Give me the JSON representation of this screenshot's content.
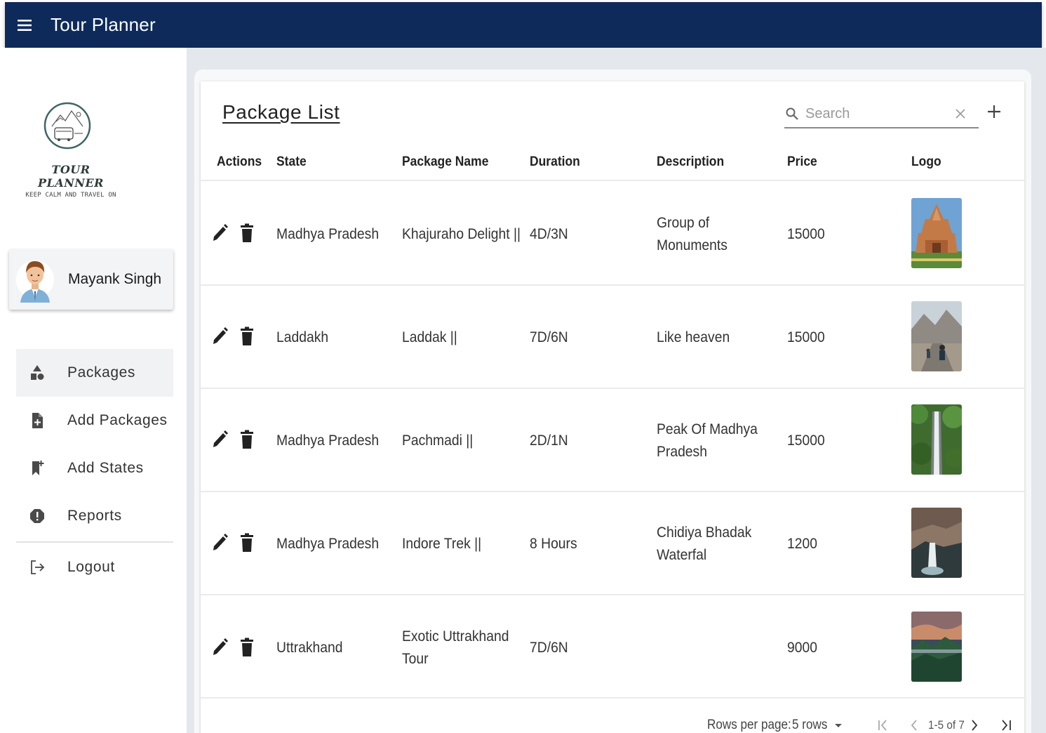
{
  "app": {
    "title": "Tour Planner"
  },
  "sidebar": {
    "logo": {
      "name": "TOUR PLANNER",
      "tagline": "KEEP CALM AND TRAVEL ON"
    },
    "user": {
      "name": "Mayank Singh"
    },
    "items": [
      {
        "label": "Packages",
        "icon": "packages-icon",
        "active": true
      },
      {
        "label": "Add Packages",
        "icon": "add-file-icon",
        "active": false
      },
      {
        "label": "Add States",
        "icon": "bookmark-add-icon",
        "active": false
      },
      {
        "label": "Reports",
        "icon": "report-icon",
        "active": false
      },
      {
        "label": "Logout",
        "icon": "logout-icon",
        "active": false
      }
    ]
  },
  "table": {
    "title": "Package List",
    "search": {
      "placeholder": "Search",
      "value": ""
    },
    "columns": [
      "Actions",
      "State",
      "Package Name",
      "Duration",
      "Description",
      "Price",
      "Logo"
    ],
    "rows": [
      {
        "state": "Madhya Pradesh",
        "package": [
          "Khajuraho Delight ||"
        ],
        "duration": "4D/3N",
        "description": [
          "Group of",
          "Monuments"
        ],
        "price": "15000",
        "logo": "temple-photo"
      },
      {
        "state": "Laddakh",
        "package": [
          "Laddak ||"
        ],
        "duration": "7D/6N",
        "description": [
          "Like heaven"
        ],
        "price": "15000",
        "logo": "mountain-road-photo"
      },
      {
        "state": "Madhya Pradesh",
        "package": [
          "Pachmadi ||"
        ],
        "duration": "2D/1N",
        "description": [
          "Peak Of Madhya",
          "Pradesh"
        ],
        "price": "15000",
        "logo": "forest-waterfall-photo"
      },
      {
        "state": "Madhya Pradesh",
        "package": [
          "Indore Trek ||"
        ],
        "duration": "8 Hours",
        "description": [
          "Chidiya Bhadak",
          "Waterfal"
        ],
        "price": "1200",
        "logo": "rock-waterfall-photo"
      },
      {
        "state": "Uttrakhand",
        "package": [
          "Exotic Uttrakhand",
          "Tour"
        ],
        "duration": "7D/6N",
        "description": [],
        "price": "9000",
        "logo": "valley-sunset-photo"
      }
    ],
    "pagination": {
      "rows_label": "Rows per page:",
      "rows_value": "5 rows",
      "range": "1-5 of 7"
    }
  },
  "colors": {
    "appbar": "#0d2a5a",
    "content_bg": "#e4e8ec",
    "active_nav": "#f1f2f4"
  }
}
